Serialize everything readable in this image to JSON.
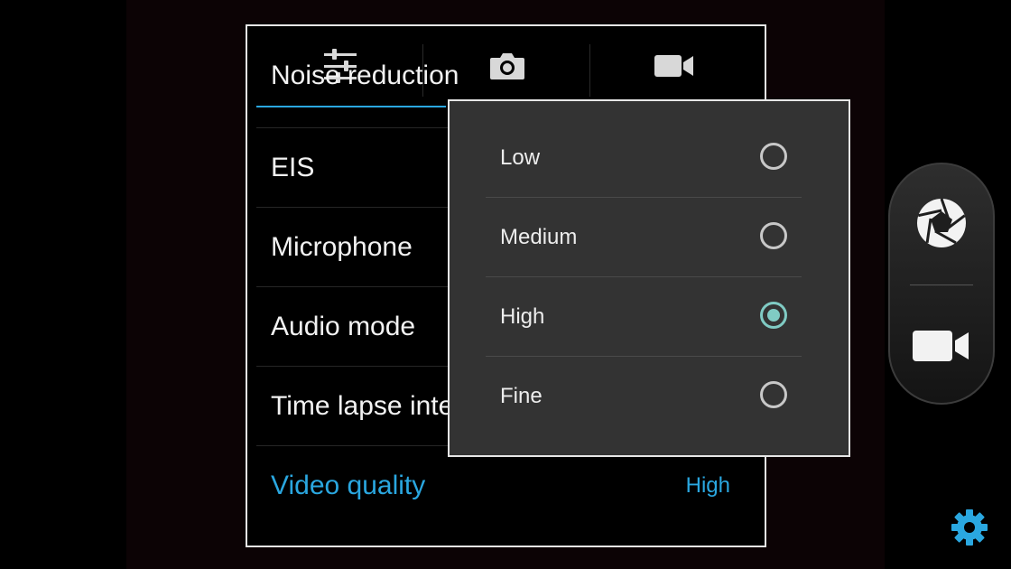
{
  "tabs": [
    {
      "name": "settings-tab",
      "icon": "sliders-icon"
    },
    {
      "name": "photo-tab",
      "icon": "camera-icon"
    },
    {
      "name": "video-tab",
      "icon": "video-camera-icon"
    }
  ],
  "settings": {
    "partial_item": "Noise reduction",
    "items": [
      {
        "label": "EIS"
      },
      {
        "label": "Microphone"
      },
      {
        "label": "Audio mode"
      },
      {
        "label": "Time lapse interval"
      }
    ],
    "active_item": {
      "label": "Video quality",
      "value": "High"
    }
  },
  "popup": {
    "options": [
      {
        "label": "Low",
        "selected": false
      },
      {
        "label": "Medium",
        "selected": false
      },
      {
        "label": "High",
        "selected": true
      },
      {
        "label": "Fine",
        "selected": false
      }
    ]
  },
  "mode_switcher": {
    "items": [
      {
        "icon": "shutter-icon"
      },
      {
        "icon": "video-camera-icon"
      }
    ]
  },
  "settings_button": {
    "icon": "gear-icon"
  },
  "colors": {
    "accent": "#2aa7e0",
    "radio_selected": "#80cbc4",
    "popup_bg": "#333333"
  }
}
